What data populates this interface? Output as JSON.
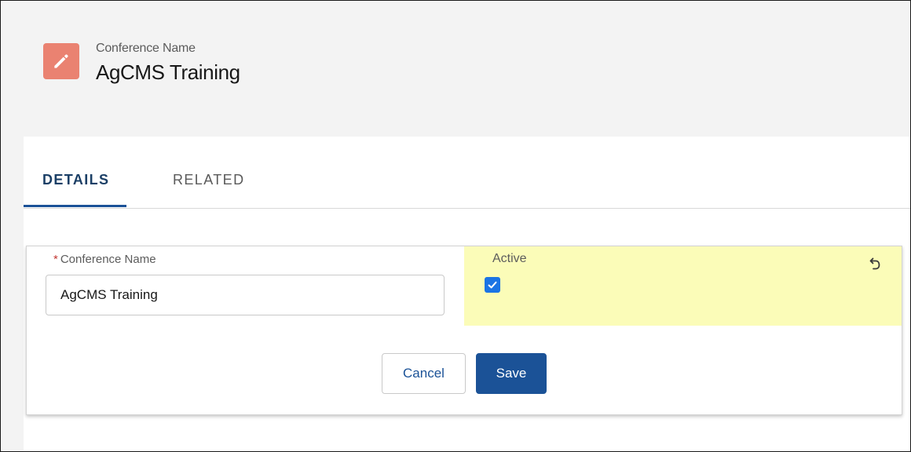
{
  "header": {
    "icon": "pencil-icon",
    "icon_color": "#ea8271",
    "label": "Conference Name",
    "title": "AgCMS Training"
  },
  "tabs": [
    {
      "label": "DETAILS",
      "active": true
    },
    {
      "label": "RELATED",
      "active": false
    }
  ],
  "form": {
    "conference_name": {
      "label": "Conference Name",
      "required_marker": "*",
      "value": "AgCMS Training"
    },
    "active": {
      "label": "Active",
      "checked": true,
      "highlight_color": "#fbfcb8",
      "undo_icon": "undo-icon"
    }
  },
  "buttons": {
    "cancel_label": "Cancel",
    "save_label": "Save"
  },
  "colors": {
    "brand_blue": "#1b5297",
    "checkbox_blue": "#1b74e4",
    "tab_active_text": "#1b3f66"
  }
}
